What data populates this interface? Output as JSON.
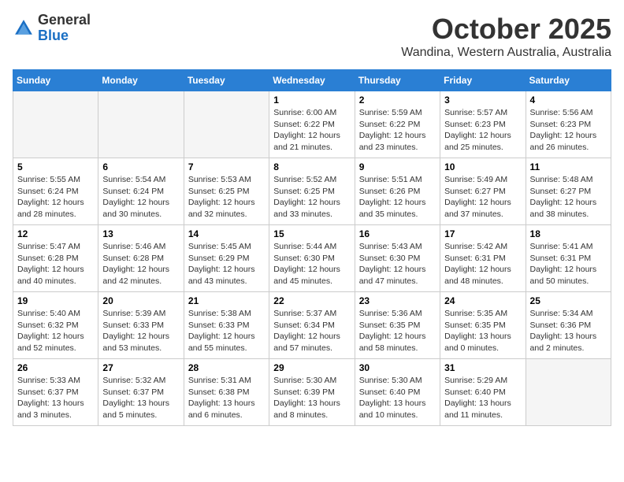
{
  "header": {
    "logo_general": "General",
    "logo_blue": "Blue",
    "title": "October 2025",
    "location": "Wandina, Western Australia, Australia"
  },
  "weekdays": [
    "Sunday",
    "Monday",
    "Tuesday",
    "Wednesday",
    "Thursday",
    "Friday",
    "Saturday"
  ],
  "weeks": [
    [
      {
        "day": "",
        "info": ""
      },
      {
        "day": "",
        "info": ""
      },
      {
        "day": "",
        "info": ""
      },
      {
        "day": "1",
        "info": "Sunrise: 6:00 AM\nSunset: 6:22 PM\nDaylight: 12 hours\nand 21 minutes."
      },
      {
        "day": "2",
        "info": "Sunrise: 5:59 AM\nSunset: 6:22 PM\nDaylight: 12 hours\nand 23 minutes."
      },
      {
        "day": "3",
        "info": "Sunrise: 5:57 AM\nSunset: 6:23 PM\nDaylight: 12 hours\nand 25 minutes."
      },
      {
        "day": "4",
        "info": "Sunrise: 5:56 AM\nSunset: 6:23 PM\nDaylight: 12 hours\nand 26 minutes."
      }
    ],
    [
      {
        "day": "5",
        "info": "Sunrise: 5:55 AM\nSunset: 6:24 PM\nDaylight: 12 hours\nand 28 minutes."
      },
      {
        "day": "6",
        "info": "Sunrise: 5:54 AM\nSunset: 6:24 PM\nDaylight: 12 hours\nand 30 minutes."
      },
      {
        "day": "7",
        "info": "Sunrise: 5:53 AM\nSunset: 6:25 PM\nDaylight: 12 hours\nand 32 minutes."
      },
      {
        "day": "8",
        "info": "Sunrise: 5:52 AM\nSunset: 6:25 PM\nDaylight: 12 hours\nand 33 minutes."
      },
      {
        "day": "9",
        "info": "Sunrise: 5:51 AM\nSunset: 6:26 PM\nDaylight: 12 hours\nand 35 minutes."
      },
      {
        "day": "10",
        "info": "Sunrise: 5:49 AM\nSunset: 6:27 PM\nDaylight: 12 hours\nand 37 minutes."
      },
      {
        "day": "11",
        "info": "Sunrise: 5:48 AM\nSunset: 6:27 PM\nDaylight: 12 hours\nand 38 minutes."
      }
    ],
    [
      {
        "day": "12",
        "info": "Sunrise: 5:47 AM\nSunset: 6:28 PM\nDaylight: 12 hours\nand 40 minutes."
      },
      {
        "day": "13",
        "info": "Sunrise: 5:46 AM\nSunset: 6:28 PM\nDaylight: 12 hours\nand 42 minutes."
      },
      {
        "day": "14",
        "info": "Sunrise: 5:45 AM\nSunset: 6:29 PM\nDaylight: 12 hours\nand 43 minutes."
      },
      {
        "day": "15",
        "info": "Sunrise: 5:44 AM\nSunset: 6:30 PM\nDaylight: 12 hours\nand 45 minutes."
      },
      {
        "day": "16",
        "info": "Sunrise: 5:43 AM\nSunset: 6:30 PM\nDaylight: 12 hours\nand 47 minutes."
      },
      {
        "day": "17",
        "info": "Sunrise: 5:42 AM\nSunset: 6:31 PM\nDaylight: 12 hours\nand 48 minutes."
      },
      {
        "day": "18",
        "info": "Sunrise: 5:41 AM\nSunset: 6:31 PM\nDaylight: 12 hours\nand 50 minutes."
      }
    ],
    [
      {
        "day": "19",
        "info": "Sunrise: 5:40 AM\nSunset: 6:32 PM\nDaylight: 12 hours\nand 52 minutes."
      },
      {
        "day": "20",
        "info": "Sunrise: 5:39 AM\nSunset: 6:33 PM\nDaylight: 12 hours\nand 53 minutes."
      },
      {
        "day": "21",
        "info": "Sunrise: 5:38 AM\nSunset: 6:33 PM\nDaylight: 12 hours\nand 55 minutes."
      },
      {
        "day": "22",
        "info": "Sunrise: 5:37 AM\nSunset: 6:34 PM\nDaylight: 12 hours\nand 57 minutes."
      },
      {
        "day": "23",
        "info": "Sunrise: 5:36 AM\nSunset: 6:35 PM\nDaylight: 12 hours\nand 58 minutes."
      },
      {
        "day": "24",
        "info": "Sunrise: 5:35 AM\nSunset: 6:35 PM\nDaylight: 13 hours\nand 0 minutes."
      },
      {
        "day": "25",
        "info": "Sunrise: 5:34 AM\nSunset: 6:36 PM\nDaylight: 13 hours\nand 2 minutes."
      }
    ],
    [
      {
        "day": "26",
        "info": "Sunrise: 5:33 AM\nSunset: 6:37 PM\nDaylight: 13 hours\nand 3 minutes."
      },
      {
        "day": "27",
        "info": "Sunrise: 5:32 AM\nSunset: 6:37 PM\nDaylight: 13 hours\nand 5 minutes."
      },
      {
        "day": "28",
        "info": "Sunrise: 5:31 AM\nSunset: 6:38 PM\nDaylight: 13 hours\nand 6 minutes."
      },
      {
        "day": "29",
        "info": "Sunrise: 5:30 AM\nSunset: 6:39 PM\nDaylight: 13 hours\nand 8 minutes."
      },
      {
        "day": "30",
        "info": "Sunrise: 5:30 AM\nSunset: 6:40 PM\nDaylight: 13 hours\nand 10 minutes."
      },
      {
        "day": "31",
        "info": "Sunrise: 5:29 AM\nSunset: 6:40 PM\nDaylight: 13 hours\nand 11 minutes."
      },
      {
        "day": "",
        "info": ""
      }
    ]
  ]
}
